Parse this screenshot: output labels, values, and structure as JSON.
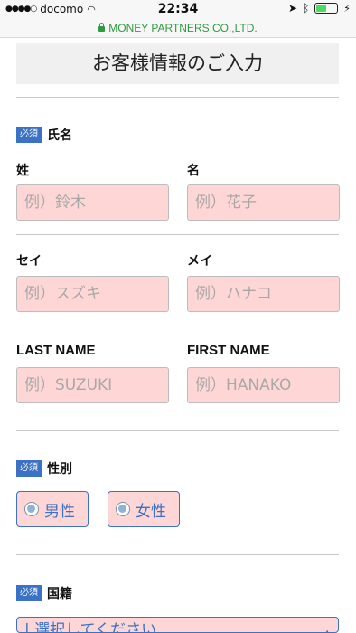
{
  "status_bar": {
    "carrier": "docomo",
    "time": "22:34",
    "battery_level": 0.5
  },
  "url_bar": {
    "url": "MONEY PARTNERS CO.,LTD."
  },
  "page": {
    "title": "お客様情報のご入力"
  },
  "required_badge": "必須",
  "name_section": {
    "title": "氏名",
    "last_name_label": "姓",
    "first_name_label": "名",
    "last_name_placeholder": "例）鈴木",
    "first_name_placeholder": "例）花子",
    "last_kana_label": "セイ",
    "first_kana_label": "メイ",
    "last_kana_placeholder": "例）スズキ",
    "first_kana_placeholder": "例）ハナコ",
    "last_roman_label": "LAST NAME",
    "first_roman_label": "FIRST NAME",
    "last_roman_placeholder": "例）SUZUKI",
    "first_roman_placeholder": "例）HANAKO"
  },
  "gender_section": {
    "title": "性別",
    "options": [
      "男性",
      "女性"
    ]
  },
  "nationality_section": {
    "title": "国籍",
    "select_value": "| 選択してください"
  }
}
